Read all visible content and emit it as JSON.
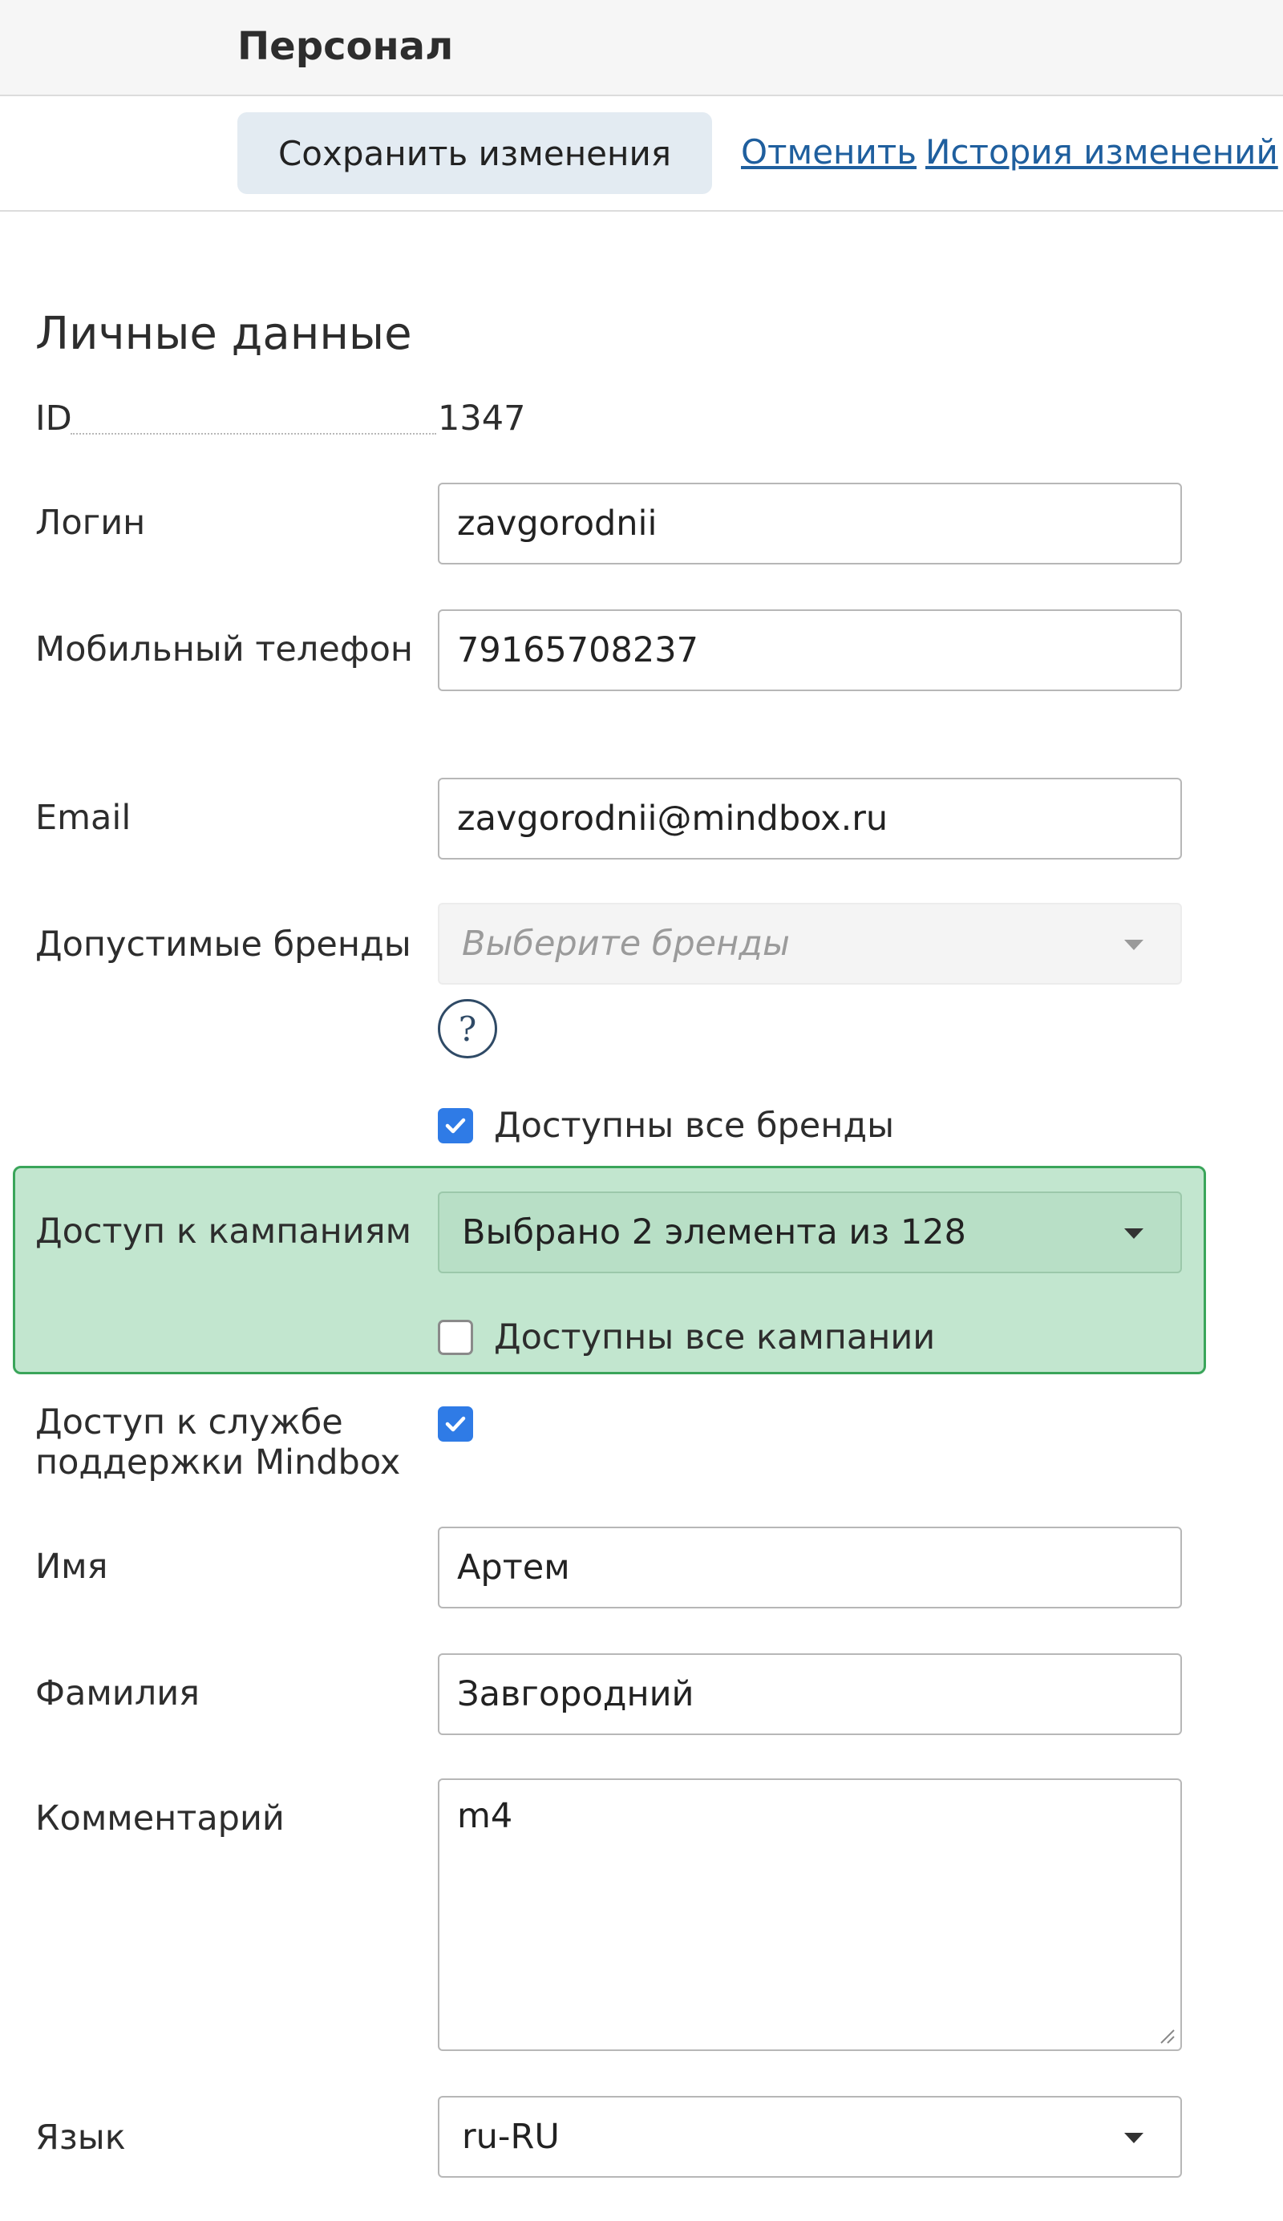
{
  "header": {
    "title": "Персонал"
  },
  "toolbar": {
    "save_label": "Сохранить изменения",
    "cancel_label": "Отменить",
    "history_label": "История изменений"
  },
  "form": {
    "section_title": "Личные данные",
    "id": {
      "label": "ID",
      "value": "1347"
    },
    "login": {
      "label": "Логин",
      "value": "zavgorodnii"
    },
    "phone": {
      "label": "Мобильный телефон",
      "value": "79165708237"
    },
    "email": {
      "label": "Email",
      "value": "zavgorodnii@mindbox.ru"
    },
    "brands": {
      "label": "Допустимые бренды",
      "placeholder": "Выберите бренды",
      "help_symbol": "?",
      "all_brands_label": "Доступны все бренды",
      "all_brands_checked": true
    },
    "campaigns": {
      "label": "Доступ к кампаниям",
      "selected_text": "Выбрано 2 элемента из 128",
      "all_campaigns_label": "Доступны все кампании",
      "all_campaigns_checked": false,
      "highlight_color": "#c2e6cf"
    },
    "support": {
      "label_line1": "Доступ к службе",
      "label_line2": "поддержки Mindbox",
      "checked": true
    },
    "first_name": {
      "label": "Имя",
      "value": "Артем"
    },
    "last_name": {
      "label": "Фамилия",
      "value": "Завгородний"
    },
    "comment": {
      "label": "Комментарий",
      "value": "m4"
    },
    "language": {
      "label": "Язык",
      "value": "ru-RU"
    }
  },
  "colors": {
    "link": "#1f5f9e",
    "checkbox_checked": "#2f7be6",
    "save_button_bg": "#e3ebf2"
  }
}
